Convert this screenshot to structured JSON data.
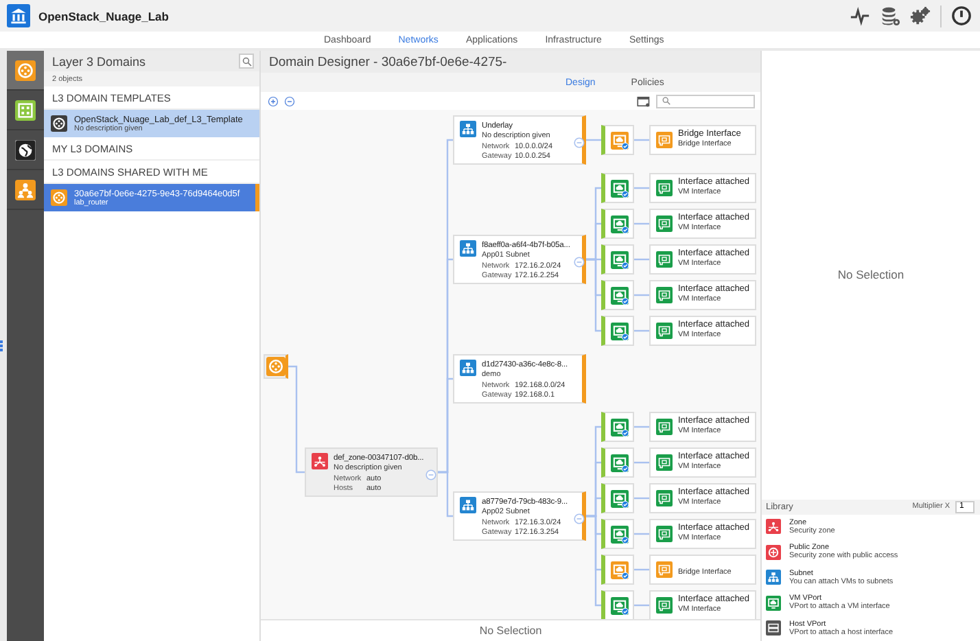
{
  "app": {
    "title": "OpenStack_Nuage_Lab"
  },
  "nav_tabs": [
    {
      "label": "Dashboard",
      "selected": false
    },
    {
      "label": "Networks",
      "selected": true
    },
    {
      "label": "Applications",
      "selected": false
    },
    {
      "label": "Infrastructure",
      "selected": false
    },
    {
      "label": "Settings",
      "selected": false
    }
  ],
  "sidebar": {
    "items": [
      {
        "kind": "router",
        "selected": true
      },
      {
        "kind": "grid",
        "selected": false
      },
      {
        "kind": "globe",
        "selected": false
      },
      {
        "kind": "people",
        "selected": false
      }
    ]
  },
  "domain_list": {
    "title": "Layer 3 Domains",
    "count": "2 objects",
    "sections": [
      {
        "title": "L3 DOMAIN TEMPLATES",
        "items": [
          {
            "name": "OpenStack_Nuage_Lab_def_L3_Template",
            "description": "No description given",
            "kind": "template",
            "highlighted": true,
            "selected": false
          }
        ]
      },
      {
        "title": "MY L3 DOMAINS"
      },
      {
        "title": "L3 DOMAINS SHARED WITH ME",
        "items": [
          {
            "name": "30a6e7bf-0e6e-4275-9e43-76d9464e0d5f",
            "description": "lab_router",
            "kind": "domain",
            "selected": true
          }
        ]
      }
    ]
  },
  "designer": {
    "title": "Domain Designer - 30a6e7bf-0e6e-4275-",
    "tabs": [
      {
        "label": "Design",
        "selected": true
      },
      {
        "label": "Policies",
        "selected": false
      }
    ],
    "zones": [
      {
        "name": "def_zone-00347107-d0b...",
        "description": "No description given",
        "fields": [
          {
            "label": "Network",
            "value": "auto"
          },
          {
            "label": "Hosts",
            "value": "auto"
          }
        ],
        "subnets": [
          {
            "name": "Underlay",
            "description": "No description given",
            "fields": [
              {
                "label": "Network",
                "value": "10.0.0.0/24"
              },
              {
                "label": "Gateway",
                "value": "10.0.0.254"
              }
            ],
            "vports": [
              {
                "kind": "bridge",
                "title": "Bridge Interface",
                "subtitle": "Bridge Interface"
              }
            ]
          },
          {
            "name": "f8aeff0a-a6f4-4b7f-b05a...",
            "description": "App01 Subnet",
            "fields": [
              {
                "label": "Network",
                "value": "172.16.2.0/24"
              },
              {
                "label": "Gateway",
                "value": "172.16.2.254"
              }
            ],
            "vports": [
              {
                "kind": "vm",
                "title": "Interface attached",
                "subtitle": "VM Interface"
              },
              {
                "kind": "vm",
                "title": "Interface attached",
                "subtitle": "VM Interface"
              },
              {
                "kind": "vm",
                "title": "Interface attached",
                "subtitle": "VM Interface"
              },
              {
                "kind": "vm",
                "title": "Interface attached",
                "subtitle": "VM Interface"
              },
              {
                "kind": "vm",
                "title": "Interface attached",
                "subtitle": "VM Interface"
              }
            ]
          },
          {
            "name": "d1d27430-a36c-4e8c-8...",
            "description": "demo",
            "fields": [
              {
                "label": "Network",
                "value": "192.168.0.0/24"
              },
              {
                "label": "Gateway",
                "value": "192.168.0.1"
              }
            ]
          },
          {
            "name": "a8779e7d-79cb-483c-9...",
            "description": "App02 Subnet",
            "fields": [
              {
                "label": "Network",
                "value": "172.16.3.0/24"
              },
              {
                "label": "Gateway",
                "value": "172.16.3.254"
              }
            ],
            "vports": [
              {
                "kind": "vm",
                "title": "Interface attached",
                "subtitle": "VM Interface"
              },
              {
                "kind": "vm",
                "title": "Interface attached",
                "subtitle": "VM Interface"
              },
              {
                "kind": "vm",
                "title": "Interface attached",
                "subtitle": "VM Interface"
              },
              {
                "kind": "vm",
                "title": "Interface attached",
                "subtitle": "VM Interface"
              },
              {
                "kind": "bridge",
                "subtitle": "Bridge Interface"
              },
              {
                "kind": "vm",
                "title": "Interface attached",
                "subtitle": "VM Interface"
              }
            ]
          }
        ]
      }
    ],
    "selection": "No Selection"
  },
  "details": {
    "selection": "No Selection",
    "library": {
      "title": "Library",
      "multiplier_label": "Multiplier X",
      "multiplier": "1",
      "items": [
        {
          "kind": "zone",
          "name": "Zone",
          "description": "Security zone"
        },
        {
          "kind": "public-zone",
          "name": "Public Zone",
          "description": "Security zone with public access"
        },
        {
          "kind": "subnet",
          "name": "Subnet",
          "description": "You can attach VMs to subnets"
        },
        {
          "kind": "vm-vport",
          "name": "VM VPort",
          "description": "VPort to attach a VM interface"
        },
        {
          "kind": "host-vport",
          "name": "Host VPort",
          "description": "VPort to attach a host interface"
        }
      ]
    }
  }
}
